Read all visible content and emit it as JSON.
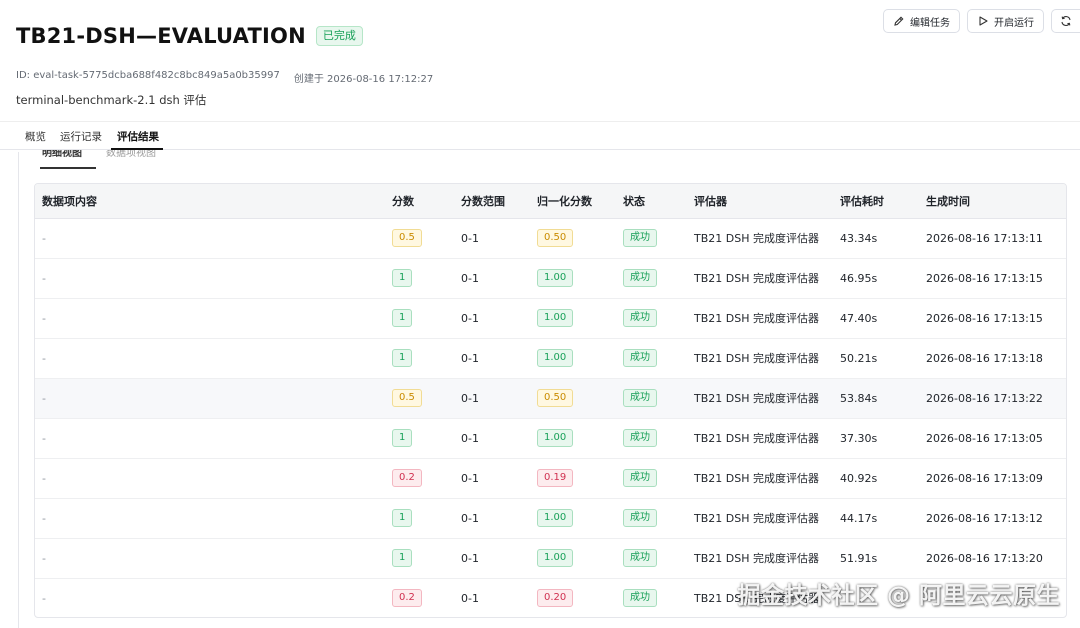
{
  "header": {
    "title": "TB21-DSH—EVALUATION",
    "status": "已完成",
    "id_text": "ID: eval-task-5775dcba688f482c8bc849a5a0b35997",
    "created_text": "创建于 2026-08-16 17:12:27",
    "description": "terminal-benchmark-2.1 dsh 评估"
  },
  "actions": {
    "edit_label": "编辑任务",
    "run_label": "开启运行"
  },
  "tabs": [
    "概览",
    "运行记录",
    "评估结果"
  ],
  "active_tab": "评估结果",
  "subtabs": [
    "明细视图",
    "数据项视图"
  ],
  "table": {
    "columns": [
      "数据项内容",
      "分数",
      "分数范围",
      "归一化分数",
      "状态",
      "评估器",
      "评估耗时",
      "生成时间"
    ],
    "rows": [
      {
        "content": "-",
        "score": "0.5",
        "range": "0-1",
        "norm": "0.50",
        "status": "成功",
        "evaluator": "TB21 DSH 完成度评估器",
        "duration": "43.34s",
        "time": "2026-08-16 17:13:11",
        "level": "mid"
      },
      {
        "content": "-",
        "score": "1",
        "range": "0-1",
        "norm": "1.00",
        "status": "成功",
        "evaluator": "TB21 DSH 完成度评估器",
        "duration": "46.95s",
        "time": "2026-08-16 17:13:15",
        "level": "ok"
      },
      {
        "content": "-",
        "score": "1",
        "range": "0-1",
        "norm": "1.00",
        "status": "成功",
        "evaluator": "TB21 DSH 完成度评估器",
        "duration": "47.40s",
        "time": "2026-08-16 17:13:15",
        "level": "ok"
      },
      {
        "content": "-",
        "score": "1",
        "range": "0-1",
        "norm": "1.00",
        "status": "成功",
        "evaluator": "TB21 DSH 完成度评估器",
        "duration": "50.21s",
        "time": "2026-08-16 17:13:18",
        "level": "ok"
      },
      {
        "content": "-",
        "score": "0.5",
        "range": "0-1",
        "norm": "0.50",
        "status": "成功",
        "evaluator": "TB21 DSH 完成度评估器",
        "duration": "53.84s",
        "time": "2026-08-16 17:13:22",
        "level": "mid",
        "highlight": true
      },
      {
        "content": "-",
        "score": "1",
        "range": "0-1",
        "norm": "1.00",
        "status": "成功",
        "evaluator": "TB21 DSH 完成度评估器",
        "duration": "37.30s",
        "time": "2026-08-16 17:13:05",
        "level": "ok"
      },
      {
        "content": "-",
        "score": "0.2",
        "range": "0-1",
        "norm": "0.19",
        "status": "成功",
        "evaluator": "TB21 DSH 完成度评估器",
        "duration": "40.92s",
        "time": "2026-08-16 17:13:09",
        "level": "bad"
      },
      {
        "content": "-",
        "score": "1",
        "range": "0-1",
        "norm": "1.00",
        "status": "成功",
        "evaluator": "TB21 DSH 完成度评估器",
        "duration": "44.17s",
        "time": "2026-08-16 17:13:12",
        "level": "ok"
      },
      {
        "content": "-",
        "score": "1",
        "range": "0-1",
        "norm": "1.00",
        "status": "成功",
        "evaluator": "TB21 DSH 完成度评估器",
        "duration": "51.91s",
        "time": "2026-08-16 17:13:20",
        "level": "ok"
      },
      {
        "content": "-",
        "score": "0.2",
        "range": "0-1",
        "norm": "0.20",
        "status": "成功",
        "evaluator": "TB21 DSH 完成度评估器",
        "duration": "",
        "time": "",
        "level": "bad"
      }
    ]
  },
  "watermark": "掘金技术社区 @ 阿里云云原生",
  "colors": {
    "success": "#18a058",
    "warning": "#c98b00",
    "danger": "#d03050"
  }
}
